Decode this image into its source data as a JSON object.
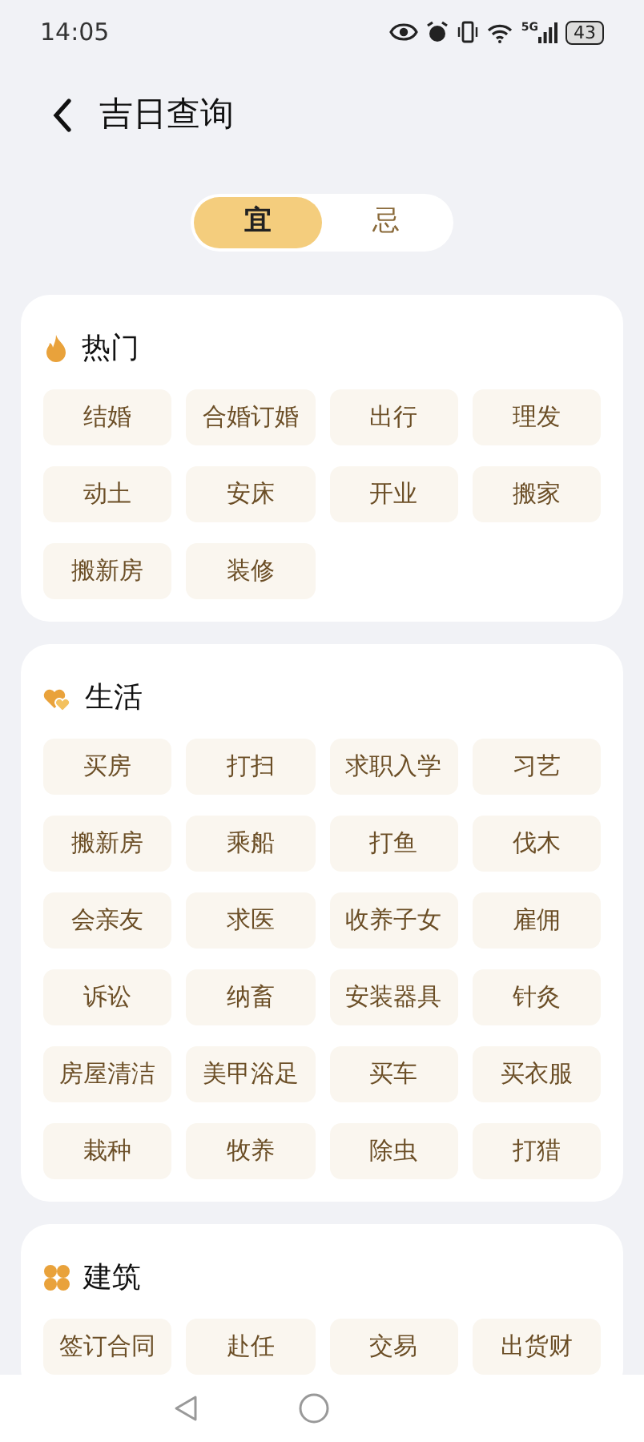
{
  "status_bar": {
    "time": "14:05",
    "network": "5G",
    "battery": "43"
  },
  "header": {
    "title": "吉日查询"
  },
  "tabs": [
    {
      "label": "宜",
      "selected": true
    },
    {
      "label": "忌",
      "selected": false
    }
  ],
  "sections": [
    {
      "kind": "flame",
      "title": "热门",
      "items": [
        "结婚",
        "合婚订婚",
        "出行",
        "理发",
        "动土",
        "安床",
        "开业",
        "搬家",
        "搬新房",
        "装修"
      ]
    },
    {
      "kind": "hearts",
      "title": "生活",
      "items": [
        "买房",
        "打扫",
        "求职入学",
        "习艺",
        "搬新房",
        "乘船",
        "打鱼",
        "伐木",
        "会亲友",
        "求医",
        "收养子女",
        "雇佣",
        "诉讼",
        "纳畜",
        "安装器具",
        "针灸",
        "房屋清洁",
        "美甲浴足",
        "买车",
        "买衣服",
        "栽种",
        "牧养",
        "除虫",
        "打猎"
      ]
    },
    {
      "kind": "clover",
      "title": "建筑",
      "items": [
        "签订合同",
        "赴任",
        "交易",
        "出货财"
      ]
    }
  ]
}
